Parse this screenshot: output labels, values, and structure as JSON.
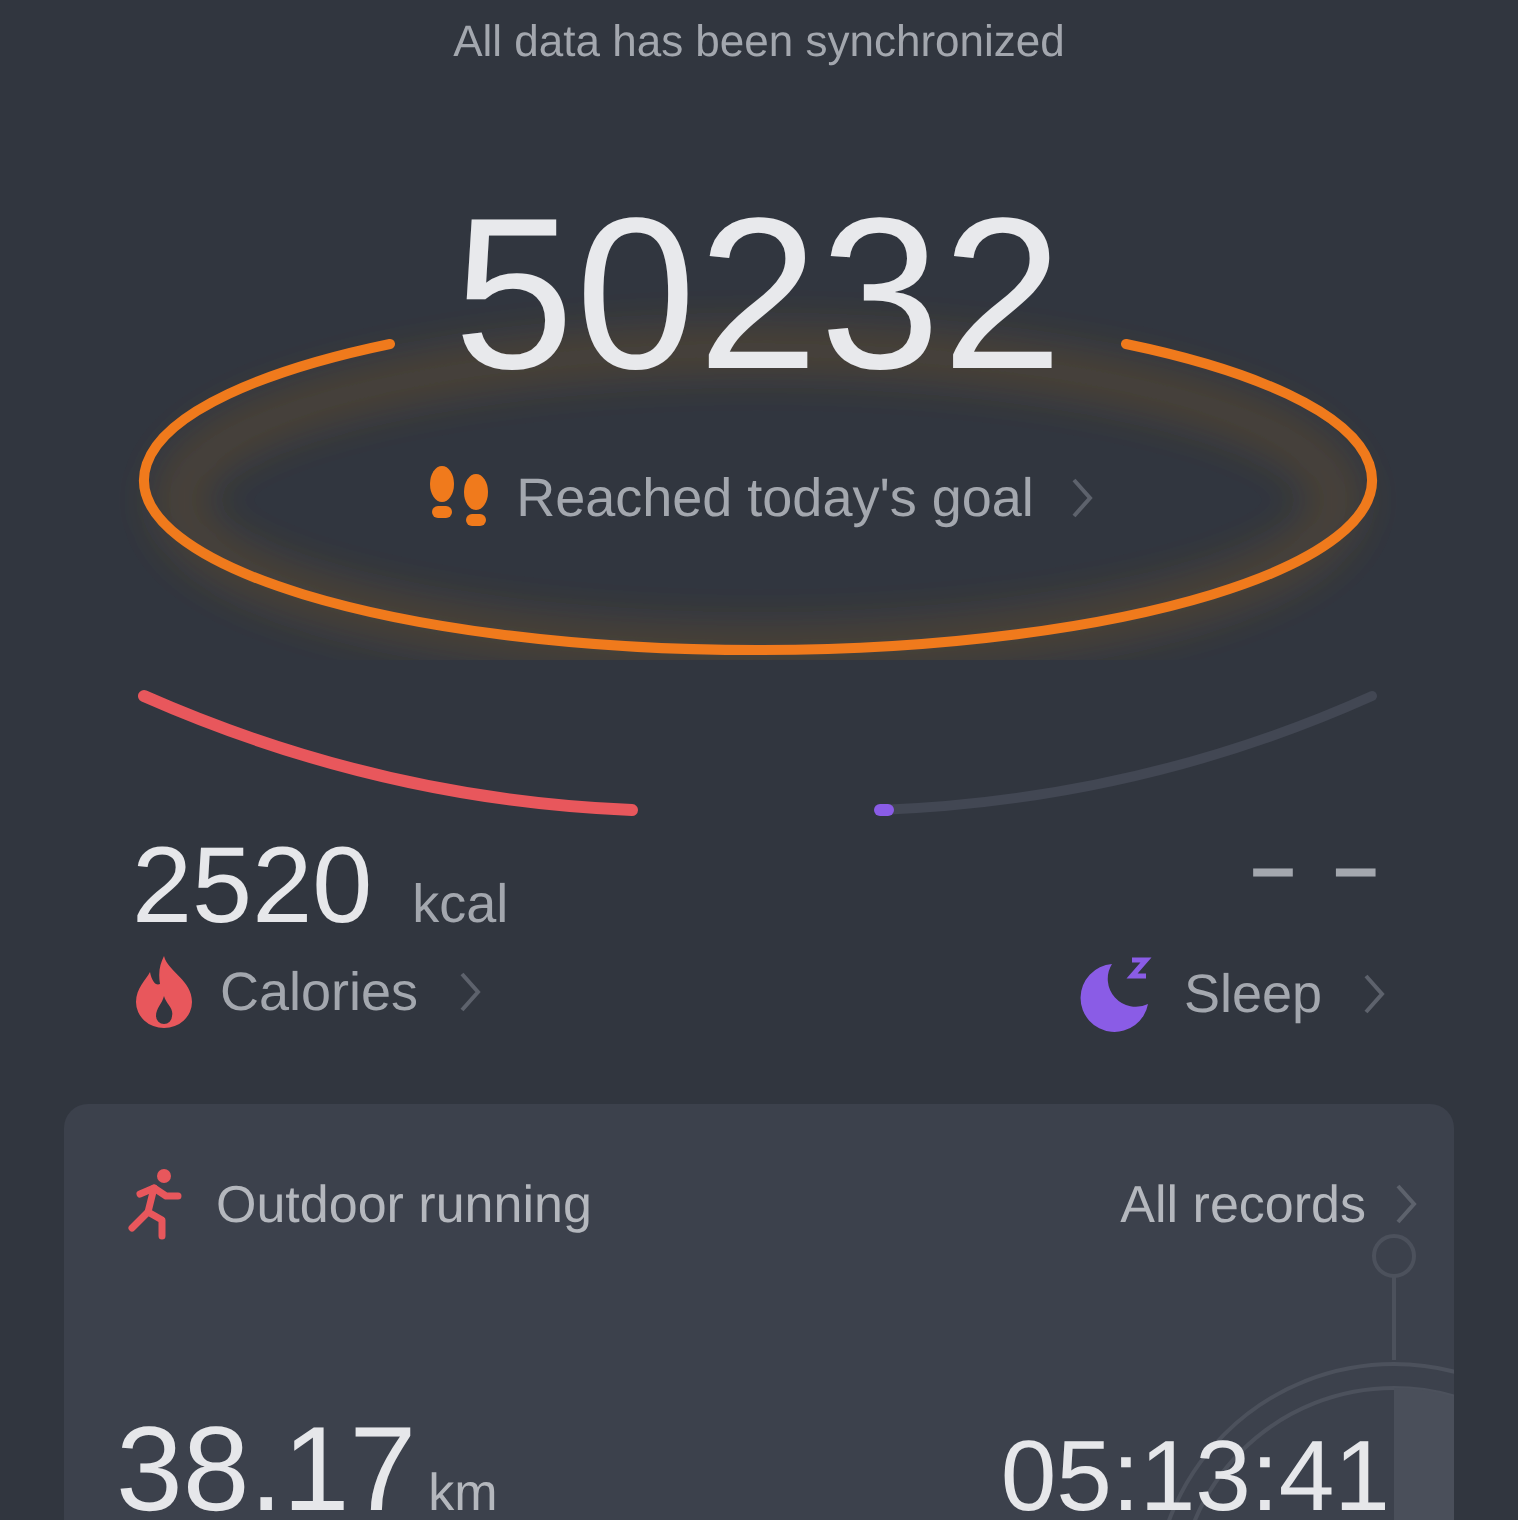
{
  "sync_status": "All data has been synchronized",
  "steps": {
    "value": "50232",
    "goal_label": "Reached today's goal"
  },
  "calories": {
    "value": "2520",
    "unit": "kcal",
    "label": "Calories"
  },
  "sleep": {
    "value": "– –",
    "label": "Sleep"
  },
  "workout": {
    "title": "Outdoor running",
    "link": "All records",
    "distance": "38.17",
    "distance_unit": "km",
    "duration": "05:13:41"
  }
}
